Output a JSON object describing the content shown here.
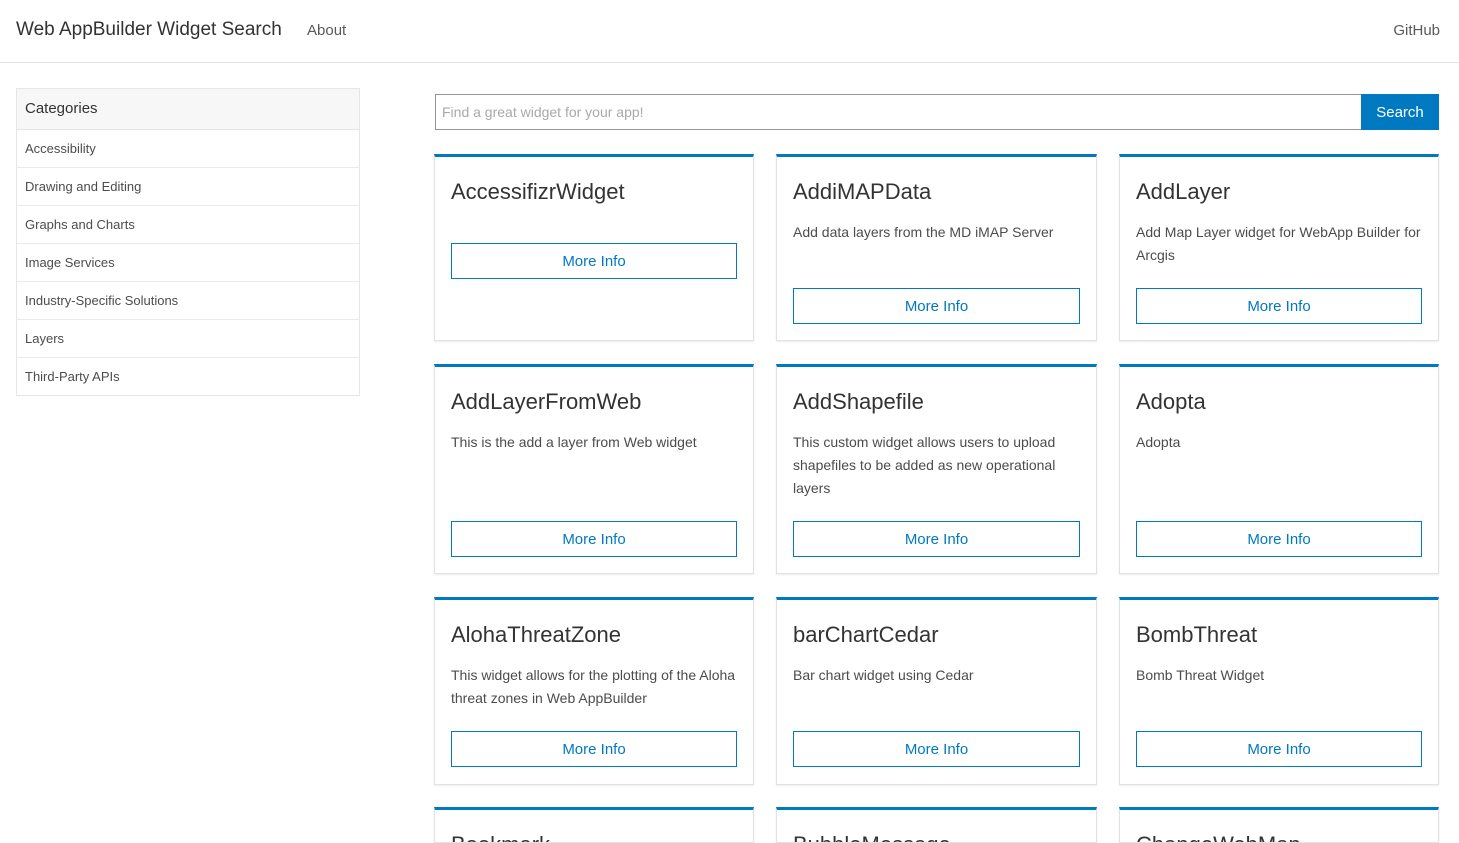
{
  "nav": {
    "brand": "Web AppBuilder Widget Search",
    "about": "About",
    "github": "GitHub"
  },
  "sidebar": {
    "header": "Categories",
    "items": [
      {
        "label": "Accessibility"
      },
      {
        "label": "Drawing and Editing"
      },
      {
        "label": "Graphs and Charts"
      },
      {
        "label": "Image Services"
      },
      {
        "label": "Industry-Specific Solutions"
      },
      {
        "label": "Layers"
      },
      {
        "label": "Third-Party APIs"
      }
    ]
  },
  "search": {
    "placeholder": "Find a great widget for your app!",
    "value": "",
    "button_label": "Search"
  },
  "cards": [
    {
      "title": "AccessifizrWidget",
      "description": "",
      "button": "More Info"
    },
    {
      "title": "AddiMAPData",
      "description": "Add data layers from the MD iMAP Server",
      "button": "More Info"
    },
    {
      "title": "AddLayer",
      "description": "Add Map Layer widget for WebApp Builder for Arcgis",
      "button": "More Info"
    },
    {
      "title": "AddLayerFromWeb",
      "description": "This is the add a layer from Web widget",
      "button": "More Info"
    },
    {
      "title": "AddShapefile",
      "description": "This custom widget allows users to upload shapefiles to be added as new operational layers",
      "button": "More Info"
    },
    {
      "title": "Adopta",
      "description": "Adopta",
      "button": "More Info"
    },
    {
      "title": "AlohaThreatZone",
      "description": "This widget allows for the plotting of the Aloha threat zones in Web AppBuilder",
      "button": "More Info"
    },
    {
      "title": "barChartCedar",
      "description": "Bar chart widget using Cedar",
      "button": "More Info"
    },
    {
      "title": "BombThreat",
      "description": "Bomb Threat Widget",
      "button": "More Info"
    },
    {
      "title": "Bookmark",
      "description": "",
      "button": ""
    },
    {
      "title": "BubbleMessage",
      "description": "",
      "button": ""
    },
    {
      "title": "ChangeWebMap",
      "description": "",
      "button": ""
    }
  ],
  "colors": {
    "accent": "#0079c1",
    "card_border_top": "#0079c1",
    "text": "#4c4c4c"
  }
}
